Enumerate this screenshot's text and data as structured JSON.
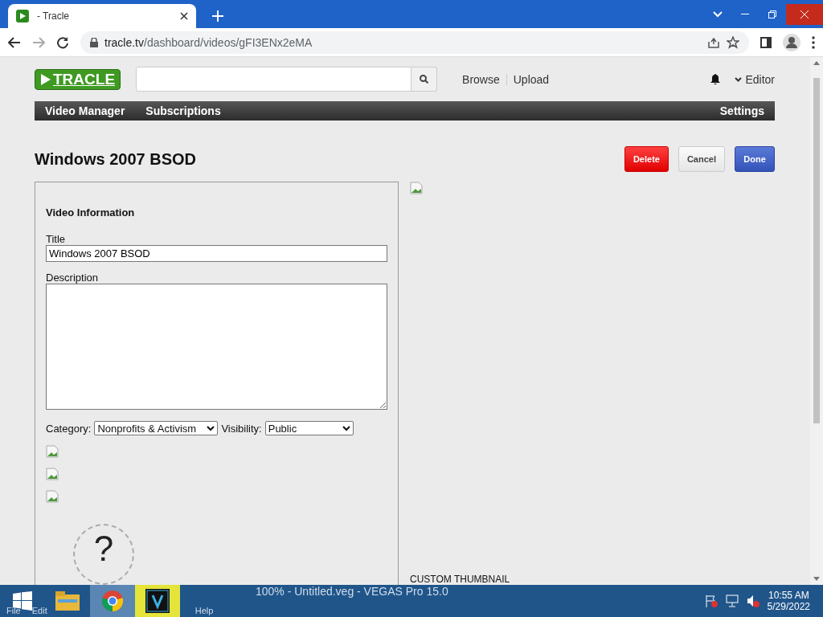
{
  "browser": {
    "tab_title": "- Tracle",
    "url_host": "tracle.tv",
    "url_path": "/dashboard/videos/gFI3ENx2eMA"
  },
  "header": {
    "logo": "TRACLE",
    "links": [
      "Browse",
      "Upload"
    ],
    "user": "Editor"
  },
  "nav": {
    "left": [
      "Video Manager",
      "Subscriptions"
    ],
    "right": "Settings"
  },
  "page_title": "Windows 2007 BSOD",
  "actions": [
    {
      "label": "Delete",
      "kind": "danger"
    },
    {
      "label": "Cancel",
      "kind": "plain"
    },
    {
      "label": "Done",
      "kind": "primary"
    }
  ],
  "form": {
    "heading": "Video Information",
    "title_label": "Title",
    "title_value": "Windows 2007 BSOD",
    "description_label": "Description",
    "category_label": "Category:",
    "category_value": "Nonprofits & Activism",
    "visibility_label": "Visibility:",
    "visibility_value": "Public",
    "help_mark": "?"
  },
  "thumbnail_label": "CUSTOM THUMBNAIL",
  "taskbar": {
    "window_title": "100% - Untitled.veg - VEGAS Pro 15.0",
    "menu": [
      "File",
      "Edit",
      "Help"
    ],
    "time": "10:55 AM",
    "date": "5/29/2022"
  }
}
